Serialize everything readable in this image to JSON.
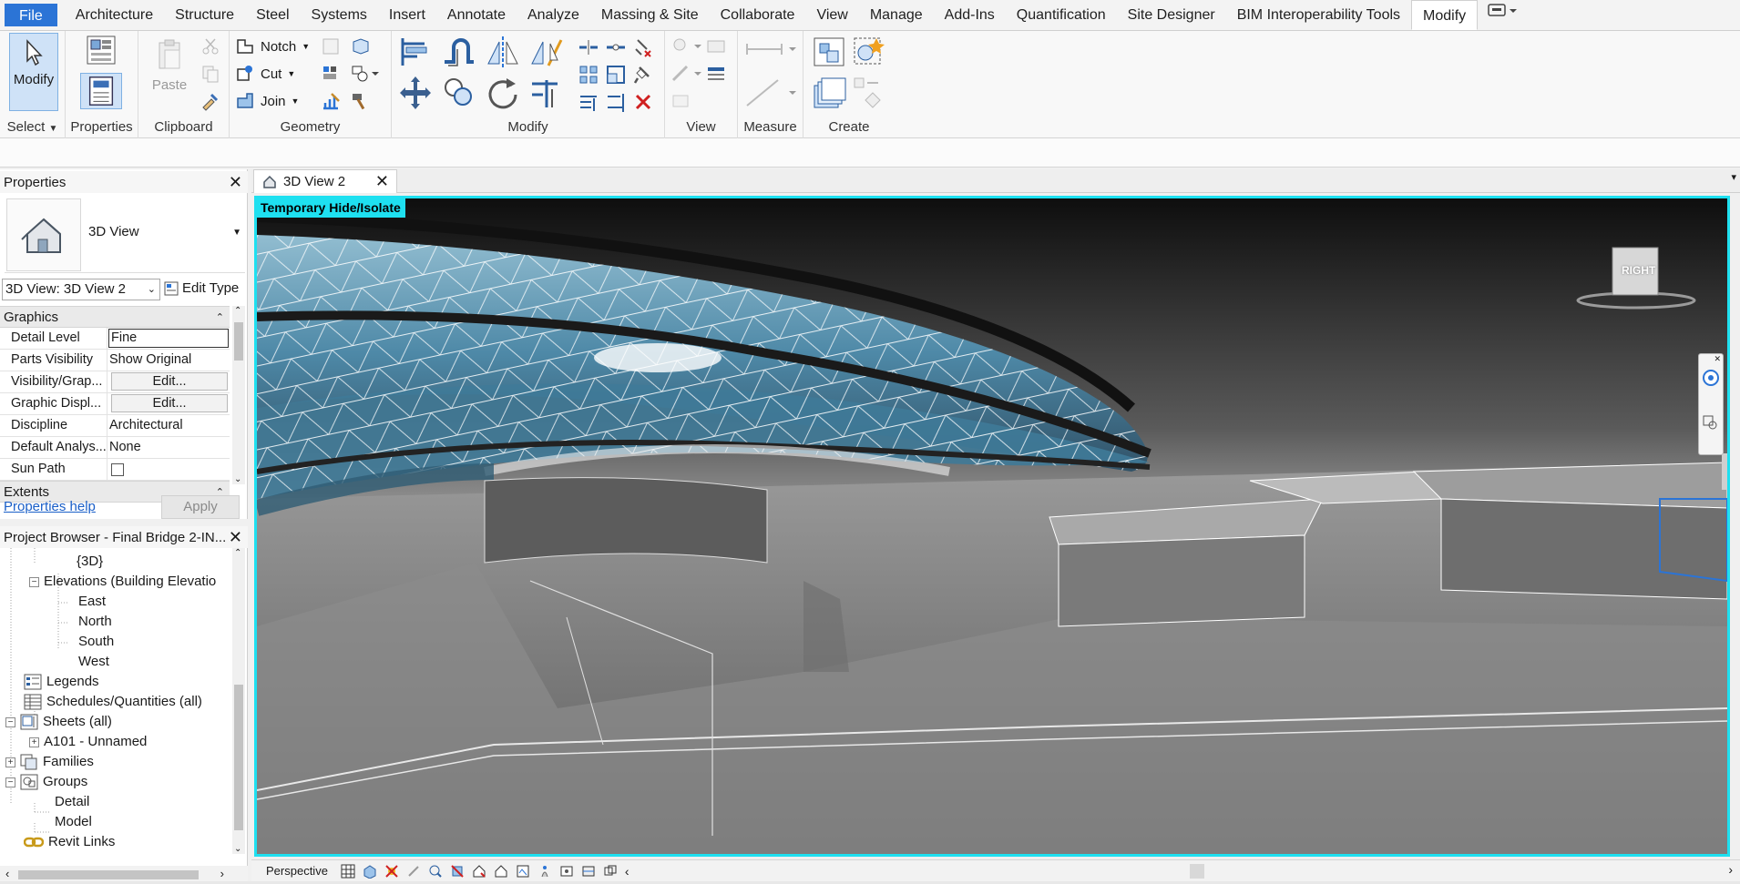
{
  "ribbon_tabs": [
    {
      "label": "File"
    },
    {
      "label": "Architecture"
    },
    {
      "label": "Structure"
    },
    {
      "label": "Steel"
    },
    {
      "label": "Systems"
    },
    {
      "label": "Insert"
    },
    {
      "label": "Annotate"
    },
    {
      "label": "Analyze"
    },
    {
      "label": "Massing & Site"
    },
    {
      "label": "Collaborate"
    },
    {
      "label": "View"
    },
    {
      "label": "Manage"
    },
    {
      "label": "Add-Ins"
    },
    {
      "label": "Quantification"
    },
    {
      "label": "Site Designer"
    },
    {
      "label": "BIM Interoperability Tools"
    },
    {
      "label": "Modify"
    }
  ],
  "ribbon": {
    "modify_button": "Modify",
    "select_label": "Select",
    "properties_label": "Properties",
    "paste_label": "Paste",
    "clipboard_label": "Clipboard",
    "notch_label": "Notch",
    "cut_label": "Cut",
    "join_label": "Join",
    "geometry_label": "Geometry",
    "modify_label": "Modify",
    "view_label": "View",
    "measure_label": "Measure",
    "create_label": "Create"
  },
  "properties": {
    "title": "Properties",
    "type_name": "3D View",
    "instance_selector": "3D View: 3D View 2",
    "edit_type": "Edit Type",
    "graphics_section": "Graphics",
    "rows": [
      {
        "name": "Detail Level",
        "value": "Fine"
      },
      {
        "name": "Parts Visibility",
        "value": "Show Original"
      },
      {
        "name": "Visibility/Grap...",
        "value": "Edit..."
      },
      {
        "name": "Graphic Displ...",
        "value": "Edit..."
      },
      {
        "name": "Discipline",
        "value": "Architectural"
      },
      {
        "name": "Default Analys...",
        "value": "None"
      },
      {
        "name": "Sun Path",
        "value": ""
      }
    ],
    "extents_section": "Extents",
    "help_link": "Properties help",
    "apply_button": "Apply"
  },
  "project_browser": {
    "title": "Project Browser - Final Bridge 2-IN...",
    "nodes": [
      {
        "label": "{3D}"
      },
      {
        "label": "Elevations (Building Elevatio"
      },
      {
        "label": "East"
      },
      {
        "label": "North"
      },
      {
        "label": "South"
      },
      {
        "label": "West"
      },
      {
        "label": "Legends"
      },
      {
        "label": "Schedules/Quantities (all)"
      },
      {
        "label": "Sheets (all)"
      },
      {
        "label": "A101 - Unnamed"
      },
      {
        "label": "Families"
      },
      {
        "label": "Groups"
      },
      {
        "label": "Detail"
      },
      {
        "label": "Model"
      },
      {
        "label": "Revit Links"
      }
    ]
  },
  "view": {
    "tab_label": "3D View 2",
    "hide_isolate_label": "Temporary Hide/Isolate",
    "viewcube_face": "RIGHT",
    "view_control_label": "Perspective"
  },
  "colors": {
    "accent_cyan": "#1ee0f0",
    "file_tab_blue": "#2b74d6",
    "glass_blue": "#5aa6c8"
  }
}
